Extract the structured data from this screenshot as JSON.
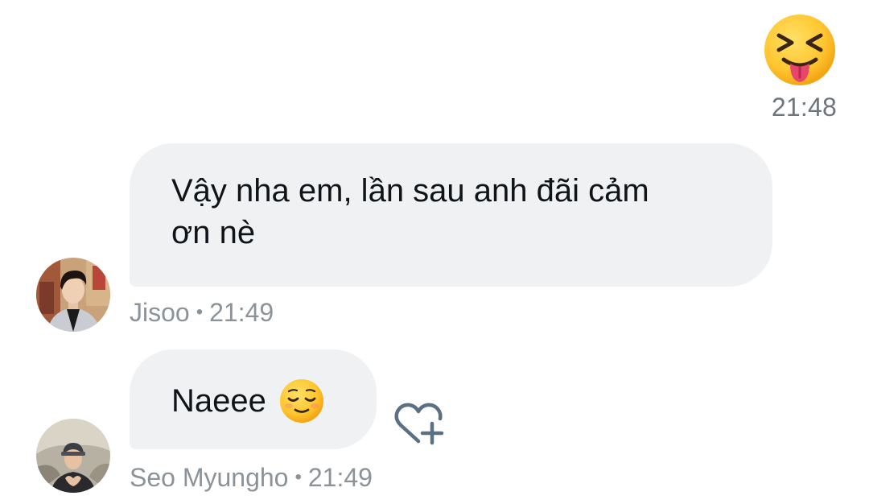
{
  "sent_message": {
    "emoji": "squinting-face-with-tongue",
    "time": "21:48"
  },
  "messages": [
    {
      "text_line1": "Vậy nha em, lần sau anh đãi cảm",
      "text_line2": "ơn nè",
      "sender": "Jisoo",
      "separator": "•",
      "time": "21:49",
      "avatar": "jisoo-avatar"
    },
    {
      "text": "Naeee",
      "emoji": "relieved-face",
      "sender": "Seo Myungho",
      "separator": "•",
      "time": "21:49",
      "avatar": "seo-myungho-avatar"
    }
  ],
  "actions": {
    "react_icon": "heart-plus-icon"
  },
  "colors": {
    "bubble_bg": "#eff1f3",
    "meta_text": "#8b9399",
    "time_text": "#6e767d",
    "icon": "#5b7083",
    "emoji_yellow": "#ffc83d"
  }
}
